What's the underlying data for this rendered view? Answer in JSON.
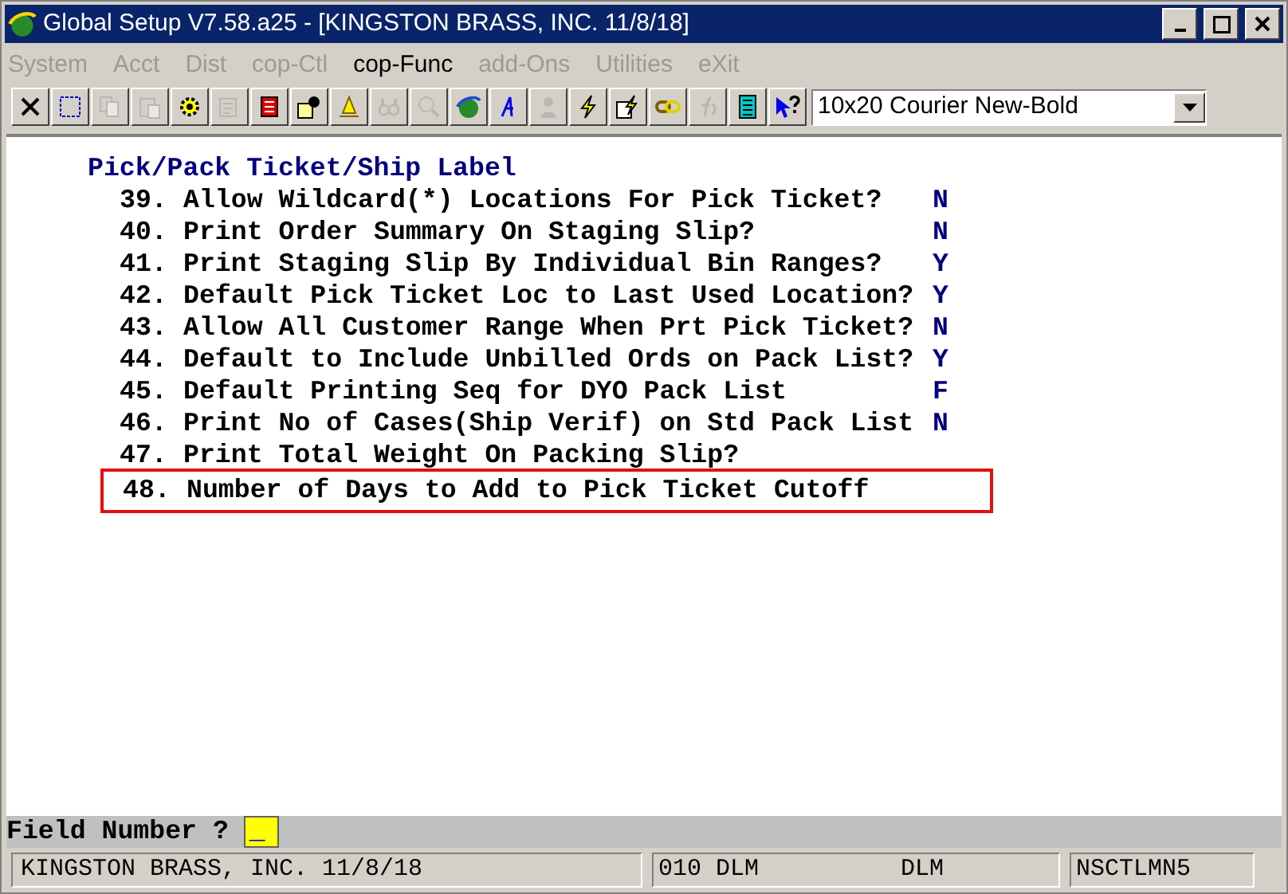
{
  "window": {
    "title": "Global Setup V7.58.a25 - [KINGSTON BRASS, INC. 11/8/18]"
  },
  "menu": [
    {
      "label": "System",
      "disabled": true
    },
    {
      "label": "Acct",
      "disabled": true
    },
    {
      "label": "Dist",
      "disabled": true
    },
    {
      "label": "cop-Ctl",
      "disabled": true
    },
    {
      "label": "cop-Func",
      "disabled": false
    },
    {
      "label": "add-Ons",
      "disabled": true
    },
    {
      "label": "Utilities",
      "disabled": true
    },
    {
      "label": "eXit",
      "disabled": true
    }
  ],
  "toolbar": [
    {
      "kind": "close",
      "disabled": false
    },
    {
      "kind": "select",
      "disabled": false
    },
    {
      "kind": "copy",
      "disabled": true
    },
    {
      "kind": "paste",
      "disabled": true
    },
    {
      "kind": "gear",
      "disabled": false
    },
    {
      "kind": "form",
      "disabled": true
    },
    {
      "kind": "list",
      "disabled": false
    },
    {
      "kind": "user",
      "disabled": false
    },
    {
      "kind": "bell",
      "disabled": false
    },
    {
      "kind": "binoculars",
      "disabled": true
    },
    {
      "kind": "magnifier",
      "disabled": true
    },
    {
      "kind": "globe",
      "disabled": false
    },
    {
      "kind": "font",
      "disabled": false
    },
    {
      "kind": "person",
      "disabled": true
    },
    {
      "kind": "lightning",
      "disabled": false
    },
    {
      "kind": "lightning-doc",
      "disabled": false
    },
    {
      "kind": "link",
      "disabled": false
    },
    {
      "kind": "function",
      "disabled": true
    },
    {
      "kind": "calculator",
      "disabled": false
    },
    {
      "kind": "help",
      "disabled": false
    }
  ],
  "font_select": {
    "value": "10x20 Courier New-Bold"
  },
  "section": {
    "title": "Pick/Pack Ticket/Ship Label",
    "fields": [
      {
        "number": "39.",
        "label": "Allow Wildcard(*) Locations For Pick Ticket?",
        "value": "N",
        "highlighted": false
      },
      {
        "number": "40.",
        "label": "Print Order Summary On Staging Slip?",
        "value": "N",
        "highlighted": false
      },
      {
        "number": "41.",
        "label": "Print Staging Slip By Individual Bin Ranges?",
        "value": "Y",
        "highlighted": false
      },
      {
        "number": "42.",
        "label": "Default Pick Ticket Loc to Last Used Location?",
        "value": "Y",
        "highlighted": false
      },
      {
        "number": "43.",
        "label": "Allow All Customer Range When Prt Pick Ticket?",
        "value": "N",
        "highlighted": false
      },
      {
        "number": "44.",
        "label": "Default to Include Unbilled Ords on Pack List?",
        "value": "Y",
        "highlighted": false
      },
      {
        "number": "45.",
        "label": "Default Printing Seq for DYO Pack List",
        "value": "F",
        "highlighted": false
      },
      {
        "number": "46.",
        "label": "Print No of Cases(Ship Verif) on Std Pack List",
        "value": "N",
        "highlighted": false
      },
      {
        "number": "47.",
        "label": "Print Total Weight On Packing Slip?",
        "highlighted": false
      },
      {
        "number": "48.",
        "label": "Number of Days to Add to Pick Ticket Cutoff",
        "highlighted": true
      }
    ]
  },
  "prompt": {
    "label": "Field Number ?",
    "value": "_"
  },
  "status_bar": [
    "KINGSTON BRASS, INC. 11/8/18",
    "010 DLM",
    "DLM",
    "NSCTLMN5"
  ]
}
